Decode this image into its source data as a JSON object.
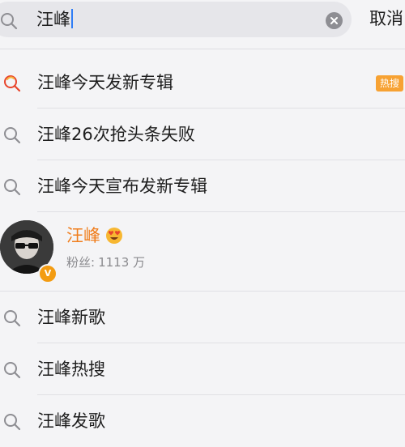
{
  "search": {
    "query": "汪峰",
    "cancel_label": "取消"
  },
  "suggestions": [
    {
      "text": "汪峰今天发新专辑",
      "badge": "热搜",
      "hot": true
    },
    {
      "text": "汪峰26次抢头条失败",
      "badge": "",
      "hot": false
    },
    {
      "text": "汪峰今天宣布发新专辑",
      "badge": "",
      "hot": false
    }
  ],
  "user": {
    "name": "汪峰",
    "fans_label": "粉丝:",
    "fans_count": "1113 万",
    "verified_mark": "V"
  },
  "more_suggestions": [
    {
      "text": "汪峰新歌"
    },
    {
      "text": "汪峰热搜"
    },
    {
      "text": "汪峰发歌"
    }
  ],
  "colors": {
    "accent_orange": "#f07e1d",
    "hot_badge": "#f7a233",
    "caret_blue": "#2f7df6",
    "hot_icon_red": "#e8452c",
    "hot_icon_yellow": "#f6b23a"
  },
  "icons": {
    "search": "search-icon",
    "clear": "clear-icon",
    "hot_search": "hot-search-icon",
    "emoji": "heart-eyes-emoji-icon"
  }
}
